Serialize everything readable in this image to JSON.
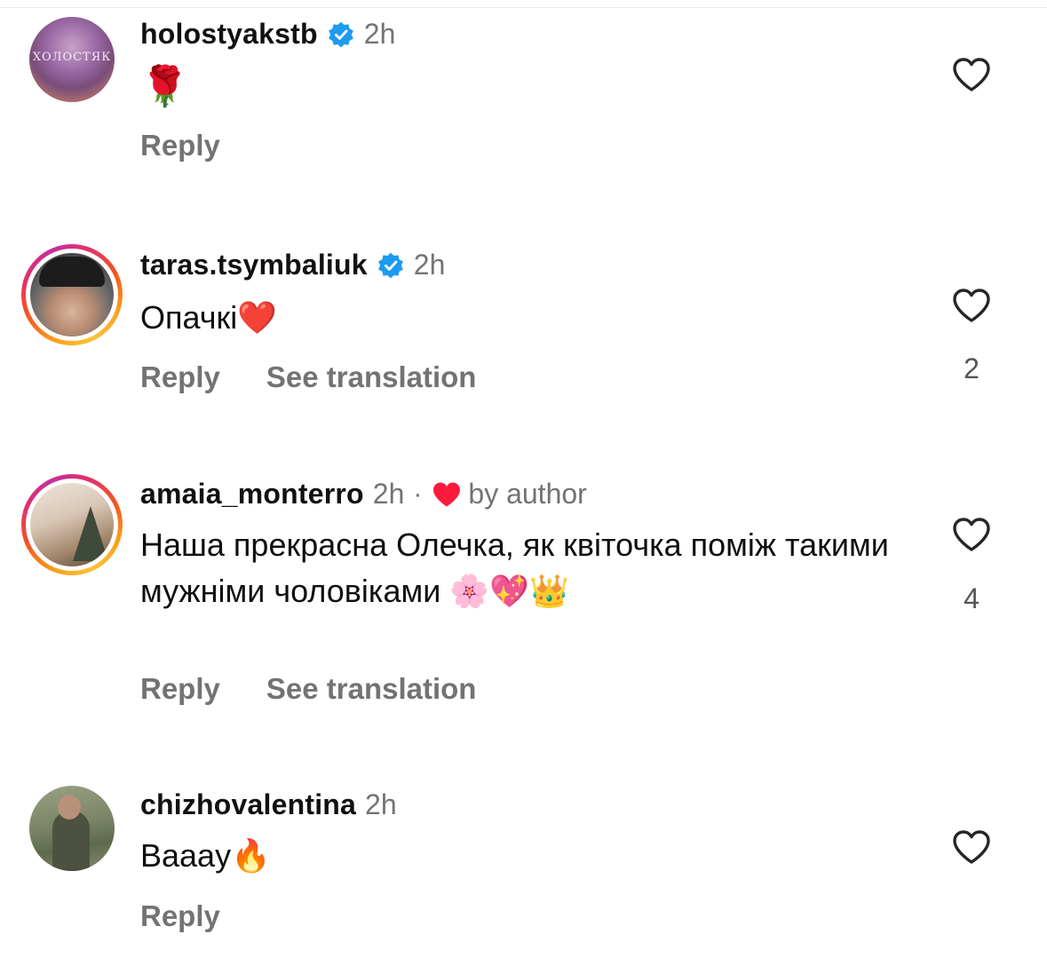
{
  "comments": [
    {
      "username": "holostyakstb",
      "verified": true,
      "time": "2h",
      "text": "🌹",
      "actions": [
        "Reply"
      ],
      "likes": null,
      "avatar_text": "ХОЛОСТЯК"
    },
    {
      "username": "taras.tsymbaliuk",
      "verified": true,
      "time": "2h",
      "text": "Опачкі❤️",
      "actions": [
        "Reply",
        "See translation"
      ],
      "likes": "2"
    },
    {
      "username": "amaia_monterro",
      "verified": false,
      "time": "2h",
      "separator": "·",
      "author_like_label": "by author",
      "text": "Наша прекрасна Олечка, як квіточка поміж такими мужніми чоловіками 🌸💖👑",
      "actions": [
        "Reply",
        "See translation"
      ],
      "likes": "4"
    },
    {
      "username": "chizhovalentina",
      "verified": false,
      "time": "2h",
      "text": "Ваааy🔥",
      "actions": [
        "Reply"
      ],
      "likes": null
    }
  ],
  "icons": {
    "like": "heart-outline-icon",
    "verified": "verified-badge-icon",
    "author_like": "heart-filled-icon"
  },
  "colors": {
    "verified": "#1d9bf0",
    "author_heart": "#ff1a3c",
    "muted": "#737373"
  }
}
